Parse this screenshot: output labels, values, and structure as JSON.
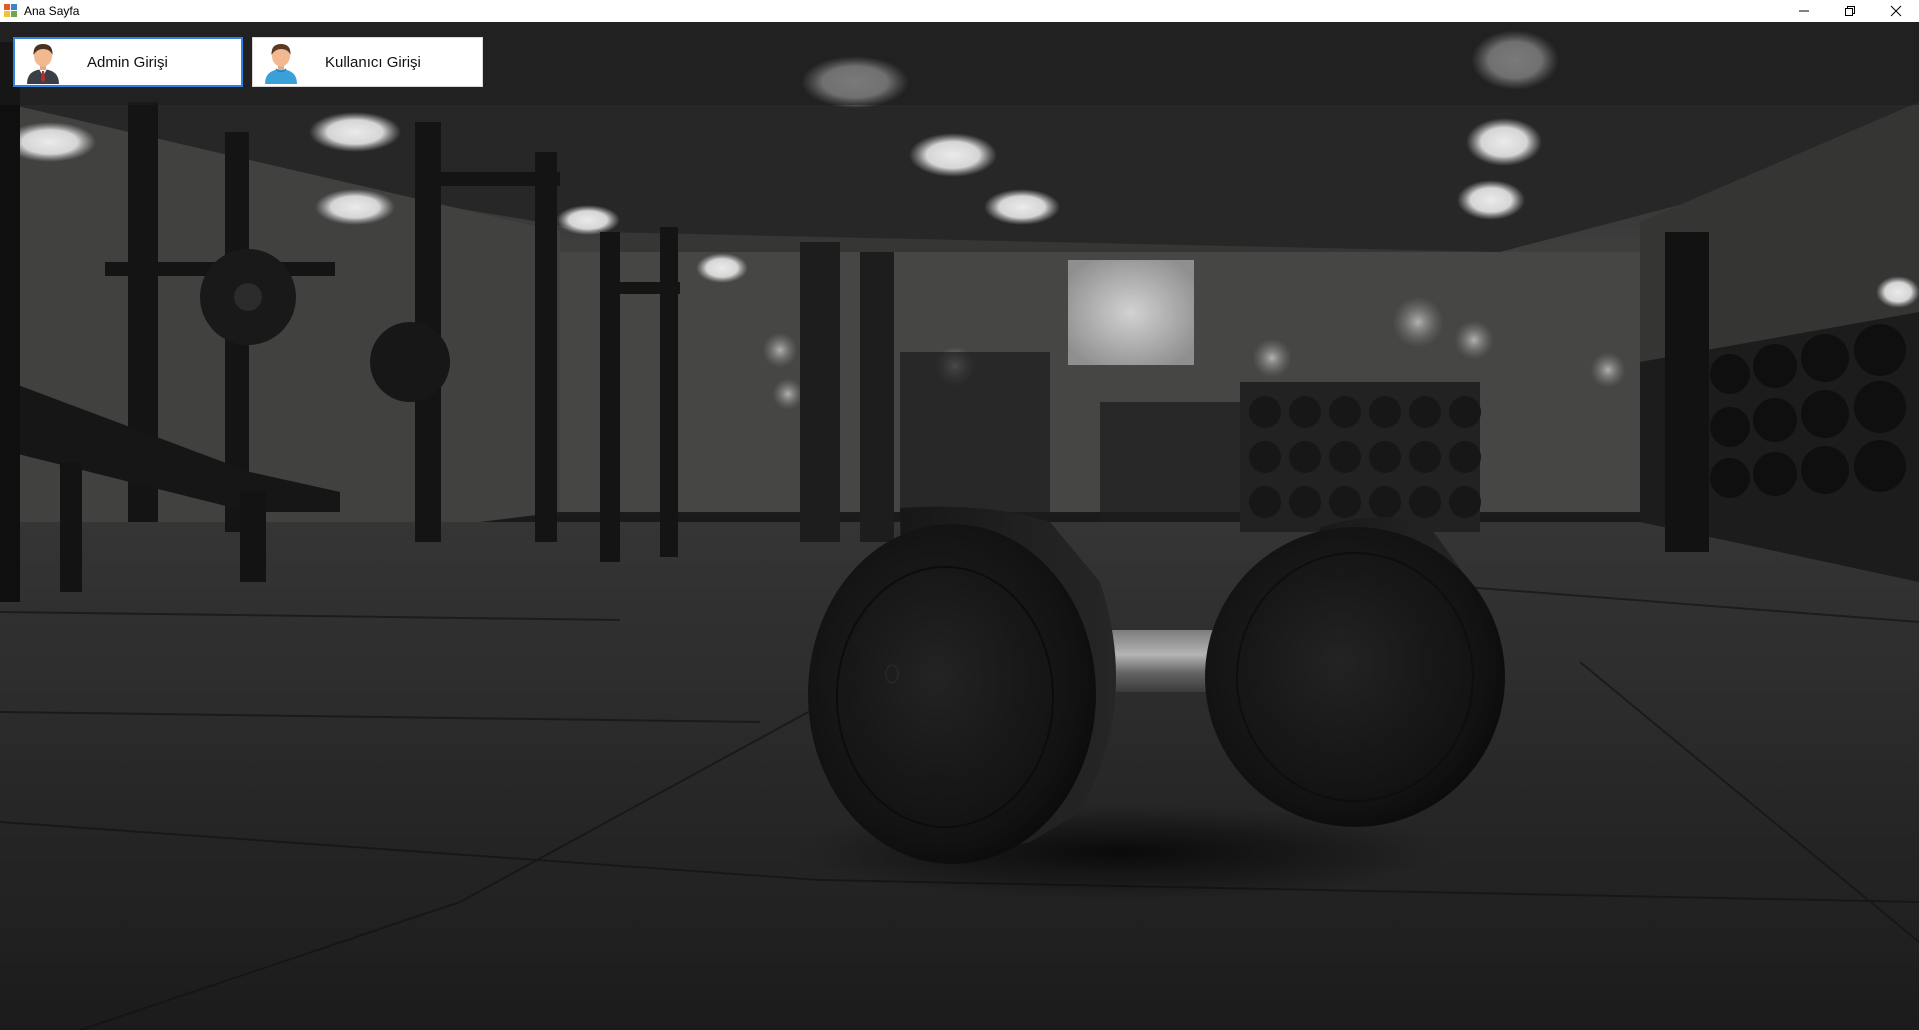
{
  "window": {
    "title": "Ana Sayfa",
    "controls": {
      "minimize_icon": "minimize-icon",
      "maximize_icon": "restore-icon",
      "close_icon": "close-icon"
    }
  },
  "buttons": {
    "admin_label": "Admin Girişi",
    "user_label": "Kullanıcı Girişi",
    "admin_icon": "admin-avatar-icon",
    "user_icon": "user-avatar-icon"
  },
  "background": {
    "subject": "gym-dumbbell-photo"
  },
  "colors": {
    "focus_border": "#2f80e0",
    "button_bg": "#ffffff"
  }
}
